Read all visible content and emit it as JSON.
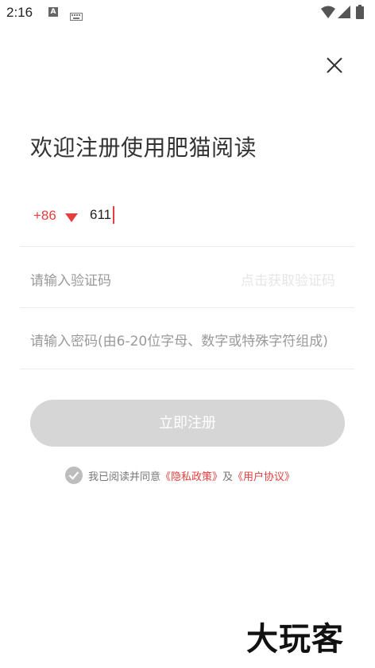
{
  "status_bar": {
    "time": "2:16",
    "notification_icon_letter": "A",
    "icons": [
      "a-notification-icon",
      "keyboard-icon",
      "wifi-icon",
      "signal-icon",
      "battery-icon"
    ]
  },
  "header": {
    "close_icon": "close-icon",
    "title": "欢迎注册使用肥猫阅读"
  },
  "phone": {
    "country_code": "+86",
    "value": "611"
  },
  "code": {
    "placeholder": "请输入验证码",
    "get_code_label": "点击获取验证码"
  },
  "password": {
    "placeholder": "请输入密码(由6-20位字母、数字或特殊字符组成)"
  },
  "register_button": {
    "label": "立即注册"
  },
  "agreement": {
    "prefix": "我已阅读并同意",
    "privacy_link": "《隐私政策》",
    "conjunction": "及",
    "terms_link": "《用户协议》"
  },
  "watermark": {
    "text": "大玩客"
  },
  "colors": {
    "accent": "#e53e3e",
    "button_disabled": "#d6d6d6",
    "placeholder": "#9a9a9a",
    "divider": "#ededed"
  }
}
